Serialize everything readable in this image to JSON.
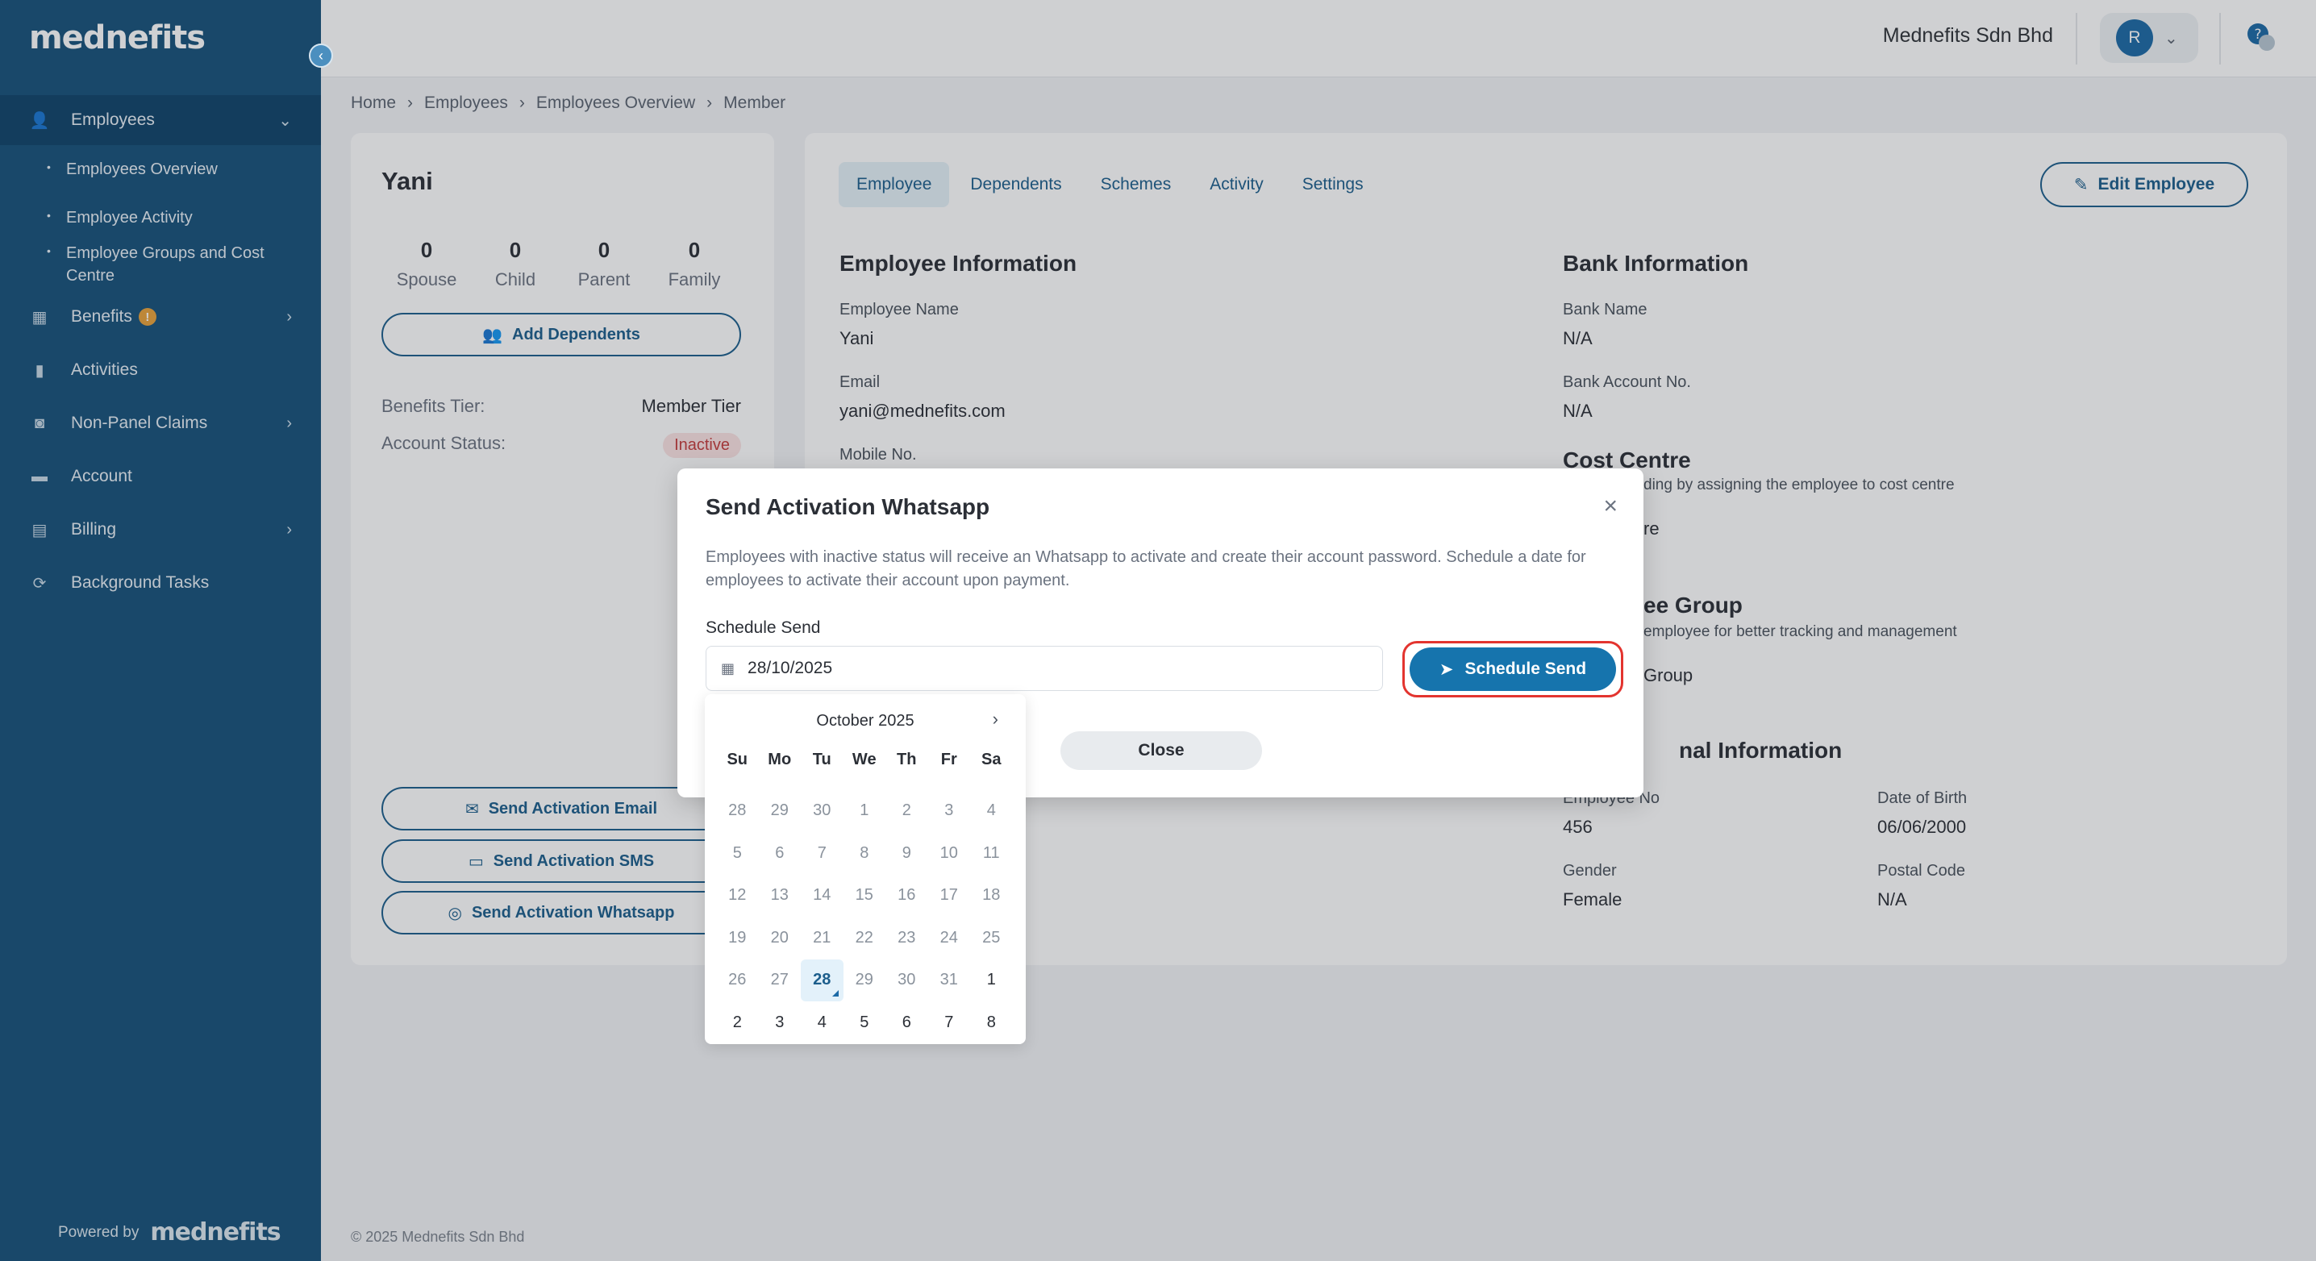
{
  "sidebar": {
    "brand": "mednefits",
    "items": [
      {
        "label": "Employees"
      },
      {
        "label": "Benefits"
      },
      {
        "label": "Activities"
      },
      {
        "label": "Non-Panel Claims"
      },
      {
        "label": "Account"
      },
      {
        "label": "Billing"
      },
      {
        "label": "Background Tasks"
      }
    ],
    "subitems": [
      "Employees Overview",
      "Employee Activity",
      "Employee Groups and Cost Centre"
    ],
    "benefits_badge": "!",
    "powered_by": "Powered by",
    "powered_logo": "mednefits"
  },
  "header": {
    "company": "Mednefits Sdn Bhd",
    "avatar_initial": "R"
  },
  "breadcrumb": [
    "Home",
    "Employees",
    "Employees Overview",
    "Member"
  ],
  "left_card": {
    "name": "Yani",
    "counts": [
      {
        "value": "0",
        "label": "Spouse"
      },
      {
        "value": "0",
        "label": "Child"
      },
      {
        "value": "0",
        "label": "Parent"
      },
      {
        "value": "0",
        "label": "Family"
      }
    ],
    "add_dependents": "Add Dependents",
    "benefits_tier_label": "Benefits Tier:",
    "benefits_tier_value": "Member Tier",
    "account_status_label": "Account Status:",
    "account_status_value": "Inactive",
    "send_email": "Send Activation Email",
    "send_sms": "Send Activation SMS",
    "send_whatsapp": "Send Activation Whatsapp"
  },
  "right_card": {
    "tabs": [
      "Employee",
      "Dependents",
      "Schemes",
      "Activity",
      "Settings"
    ],
    "edit_button": "Edit Employee",
    "employee_info": {
      "title": "Employee Information",
      "name_label": "Employee Name",
      "name_value": "Yani",
      "email_label": "Email",
      "email_value": "yani@mednefits.com",
      "mobile_label": "Mobile No."
    },
    "bank_info": {
      "title": "Bank Information",
      "bank_name_label": "Bank Name",
      "bank_name_value": "N/A",
      "account_label": "Bank Account No.",
      "account_value": "N/A"
    },
    "cost_centre": {
      "title": "Cost Centre",
      "note": "ding by assigning the employee to cost centre",
      "partial": "re"
    },
    "employee_group": {
      "title": "ee Group",
      "note": "employee for better tracking and management",
      "partial": "Group"
    },
    "personal_info": {
      "title": "nal Information",
      "emp_no_label": "Employee No",
      "emp_no_value": "456",
      "dob_label": "Date of Birth",
      "dob_value": "06/06/2000",
      "gender_label": "Gender",
      "gender_value": "Female",
      "postal_label": "Postal Code",
      "postal_value": "N/A"
    }
  },
  "footer": "© 2025 Mednefits Sdn Bhd",
  "modal": {
    "title": "Send Activation Whatsapp",
    "description": "Employees with inactive status will receive an Whatsapp to activate and create their account password. Schedule a date for employees to activate their account upon payment.",
    "schedule_label": "Schedule Send",
    "date_value": "28/10/2025",
    "schedule_button": "Schedule Send",
    "close_button": "Close"
  },
  "calendar": {
    "month": "October 2025",
    "weekdays": [
      "Su",
      "Mo",
      "Tu",
      "We",
      "Th",
      "Fr",
      "Sa"
    ],
    "weeks": [
      [
        "28",
        "29",
        "30",
        "1",
        "2",
        "3",
        "4"
      ],
      [
        "5",
        "6",
        "7",
        "8",
        "9",
        "10",
        "11"
      ],
      [
        "12",
        "13",
        "14",
        "15",
        "16",
        "17",
        "18"
      ],
      [
        "19",
        "20",
        "21",
        "22",
        "23",
        "24",
        "25"
      ],
      [
        "26",
        "27",
        "28",
        "29",
        "30",
        "31",
        "1"
      ],
      [
        "2",
        "3",
        "4",
        "5",
        "6",
        "7",
        "8"
      ]
    ],
    "selected": "28"
  }
}
